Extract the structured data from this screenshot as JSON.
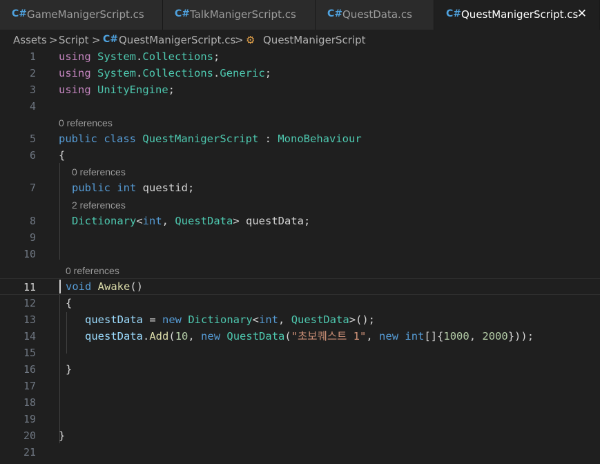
{
  "tabs": [
    {
      "icon": "C#",
      "label": "GameManigerScript.cs"
    },
    {
      "icon": "C#",
      "label": "TalkManigerScript.cs"
    },
    {
      "icon": "C#",
      "label": "QuestData.cs"
    },
    {
      "icon": "C#",
      "label": "QuestManigerScript.cs",
      "close": "✕"
    }
  ],
  "breadcrumb": {
    "folder1": "Assets",
    "sep": ">",
    "folder2": "Script",
    "file": "QuestManigerScript.cs",
    "symbol": "QuestManigerScript"
  },
  "lens": {
    "class_refs": "0 references",
    "questid_refs": "0 references",
    "questData_refs": "2 references",
    "awake_refs": "0 references"
  },
  "lines": {
    "1": [
      "using",
      " ",
      "System",
      ".",
      "Collections",
      ";"
    ],
    "2": [
      "using",
      " ",
      "System",
      ".",
      "Collections",
      ".",
      "Generic",
      ";"
    ],
    "3": [
      "using",
      " ",
      "UnityEngine",
      ";"
    ],
    "5": [
      "public",
      " ",
      "class",
      " ",
      "QuestManigerScript",
      " : ",
      "MonoBehaviour"
    ],
    "6": [
      "{"
    ],
    "7": [
      "public",
      " ",
      "int",
      " questid;"
    ],
    "8": [
      "Dictionary",
      "<",
      "int",
      ", ",
      "QuestData",
      "> questData;"
    ],
    "11": [
      "void",
      " ",
      "Awake",
      "()"
    ],
    "12": [
      "{"
    ],
    "13": [
      "questData",
      " = ",
      "new",
      " ",
      "Dictionary",
      "<",
      "int",
      ", ",
      "QuestData",
      ">();"
    ],
    "14": [
      "questData",
      ".",
      "Add",
      "(",
      "10",
      ", ",
      "new",
      " ",
      "QuestData",
      "(",
      "\"초보퀘스트 1\"",
      ", ",
      "new",
      " ",
      "int",
      "[]{",
      "1000",
      ", ",
      "2000",
      "}));"
    ],
    "16": [
      "}"
    ],
    "20": [
      "}"
    ]
  },
  "line_numbers": [
    "1",
    "2",
    "3",
    "4",
    "5",
    "6",
    "7",
    "8",
    "9",
    "10",
    "11",
    "12",
    "13",
    "14",
    "15",
    "16",
    "17",
    "18",
    "19",
    "20",
    "21"
  ],
  "active_line": "11",
  "colors": {
    "keyword": "#569cd6",
    "using": "#c586c0",
    "type": "#4ec9b0",
    "variable": "#9cdcfe",
    "function": "#dcdcaa",
    "string": "#ce9178",
    "number": "#b5cea8",
    "background": "#1f1f1f"
  }
}
